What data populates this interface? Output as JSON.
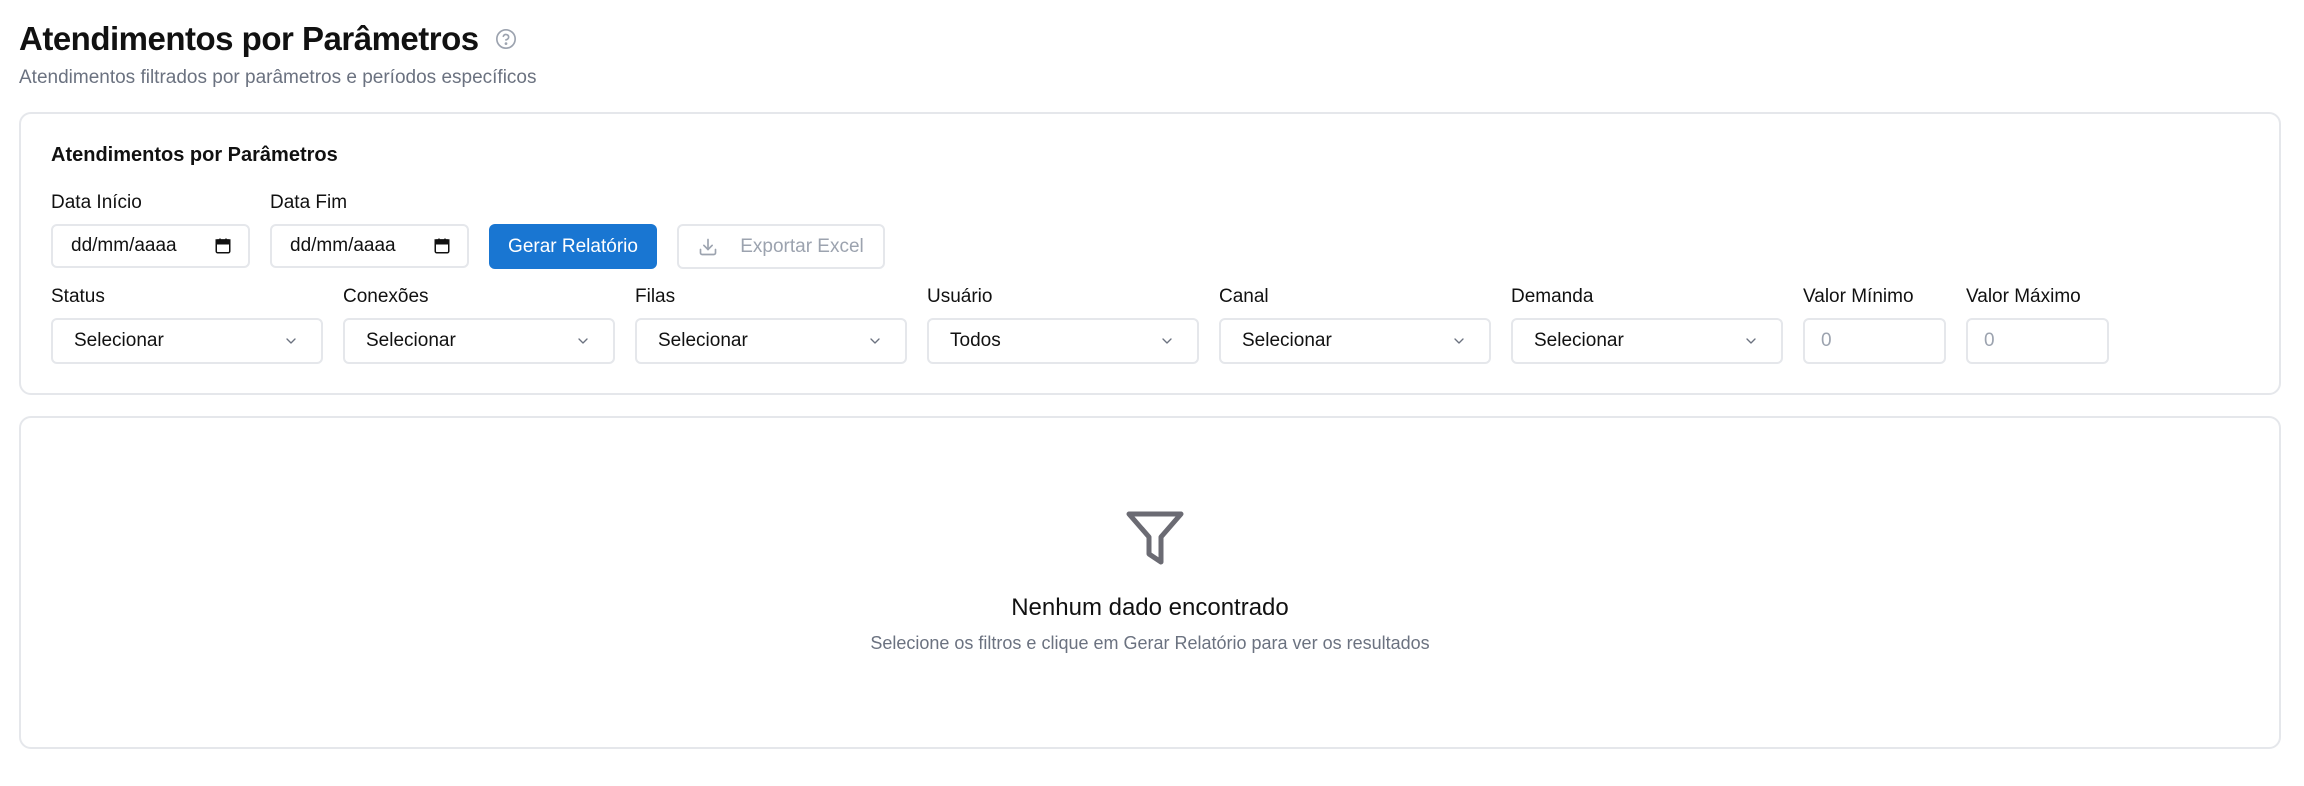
{
  "header": {
    "title": "Atendimentos por Parâmetros",
    "subtitle": "Atendimentos filtrados por parâmetros e períodos específicos"
  },
  "filters": {
    "card_title": "Atendimentos por Parâmetros",
    "date_start": {
      "label": "Data Início",
      "value": "dd/mm/aaaa"
    },
    "date_end": {
      "label": "Data Fim",
      "value": "dd/mm/aaaa"
    },
    "generate_button": "Gerar Relatório",
    "export_button": "Exportar Excel",
    "status": {
      "label": "Status",
      "value": "Selecionar"
    },
    "conexoes": {
      "label": "Conexões",
      "value": "Selecionar"
    },
    "filas": {
      "label": "Filas",
      "value": "Selecionar"
    },
    "usuario": {
      "label": "Usuário",
      "value": "Todos"
    },
    "canal": {
      "label": "Canal",
      "value": "Selecionar"
    },
    "demanda": {
      "label": "Demanda",
      "value": "Selecionar"
    },
    "valor_minimo": {
      "label": "Valor Mínimo",
      "placeholder": "0"
    },
    "valor_maximo": {
      "label": "Valor Máximo",
      "placeholder": "0"
    }
  },
  "results": {
    "empty_title": "Nenhum dado encontrado",
    "empty_description": "Selecione os filtros e clique em Gerar Relatório para ver os resultados"
  },
  "colors": {
    "primary": "#1976d2",
    "border": "#e5e7eb",
    "muted_text": "#6b7280",
    "icon": "#6b6b73"
  },
  "icons": {
    "help": "help-circle-icon",
    "calendar": "calendar-icon",
    "download": "download-icon",
    "chevron": "chevron-down-icon",
    "empty_state": "filter-icon"
  }
}
